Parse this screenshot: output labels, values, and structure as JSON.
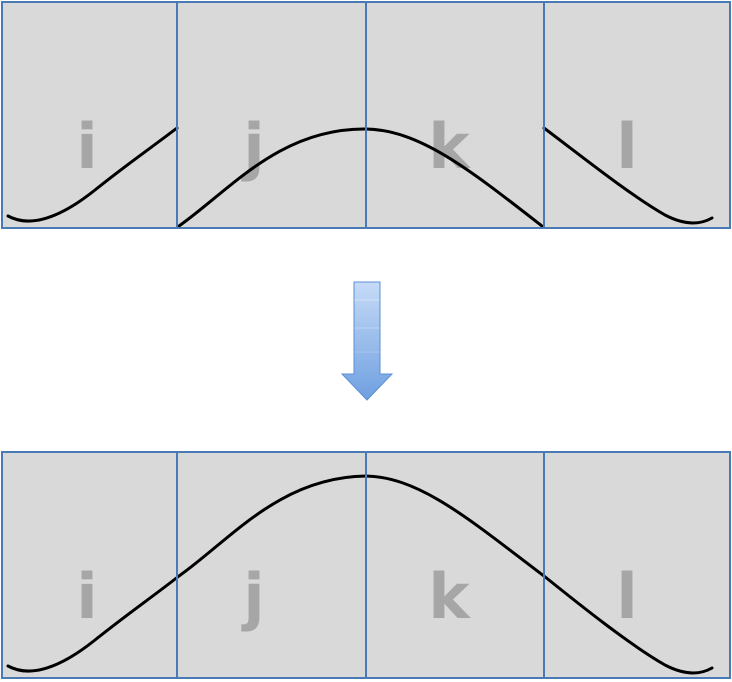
{
  "colors": {
    "cell_fill": "#d9d9d9",
    "cell_border": "#4a7ab5",
    "label": "#a6a6a6",
    "curve": "#000000",
    "arrow_top": "#c6dbf7",
    "arrow_bottom": "#6f9fe0",
    "arrow_stroke": "#5b8fd6"
  },
  "top_panel": {
    "cells": [
      {
        "label": "i"
      },
      {
        "label": "j"
      },
      {
        "label": "k"
      },
      {
        "label": "l"
      }
    ]
  },
  "bottom_panel": {
    "cells": [
      {
        "label": "i"
      },
      {
        "label": "j"
      },
      {
        "label": "k"
      },
      {
        "label": "l"
      }
    ]
  },
  "arrow": {
    "direction": "down",
    "icon": "down-arrow-icon"
  }
}
